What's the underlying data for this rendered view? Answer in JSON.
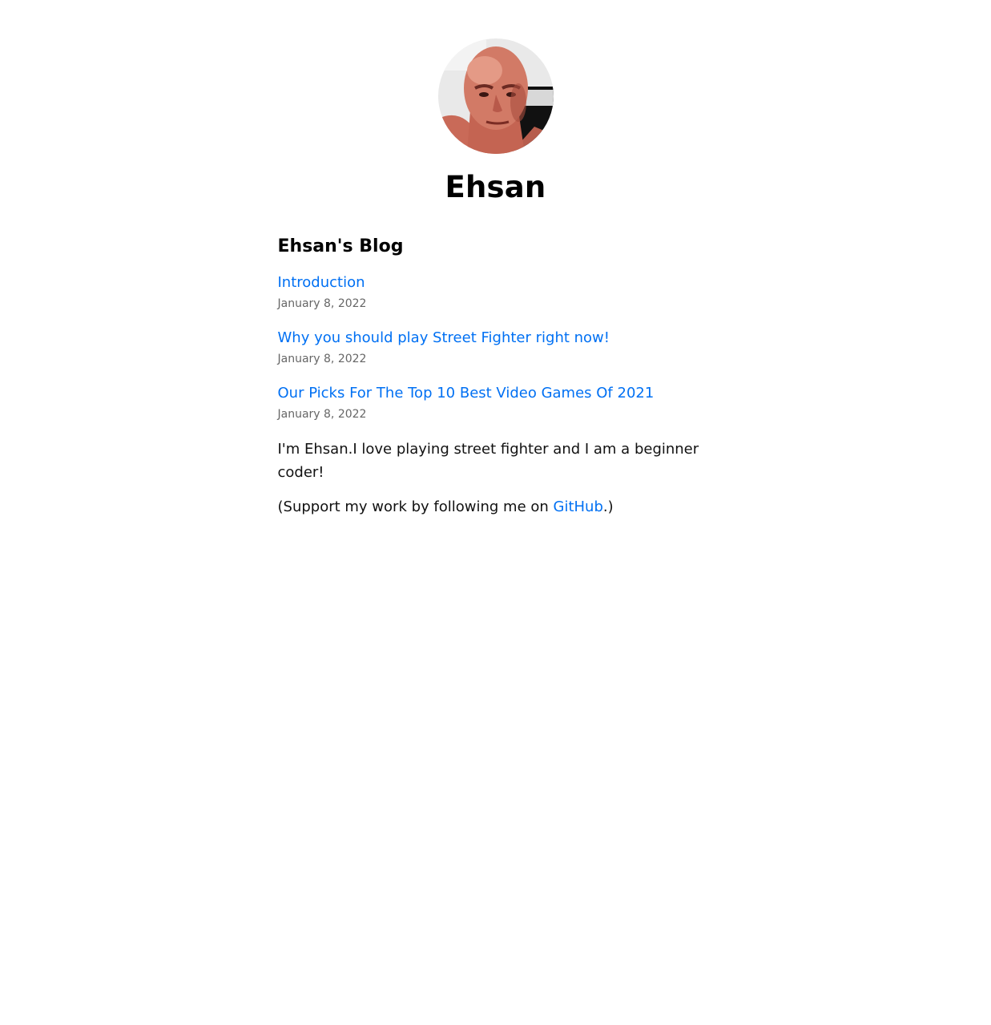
{
  "header": {
    "avatar_alt": "Ehsan",
    "site_title": "Ehsan"
  },
  "blog": {
    "heading": "Ehsan's Blog",
    "posts": [
      {
        "title": "Introduction",
        "date": "January 8, 2022"
      },
      {
        "title": "Why you should play Street Fighter right now!",
        "date": "January 8, 2022"
      },
      {
        "title": "Our Picks For The Top 10 Best Video Games Of 2021",
        "date": "January 8, 2022"
      }
    ]
  },
  "bio": {
    "text": "I'm Ehsan.I love playing street fighter and I am a beginner coder!"
  },
  "support": {
    "prefix": "(Support my work by following me on ",
    "link_label": "GitHub",
    "suffix": ".)"
  },
  "colors": {
    "link": "#0070f3",
    "date": "#666666",
    "text": "#111111"
  }
}
